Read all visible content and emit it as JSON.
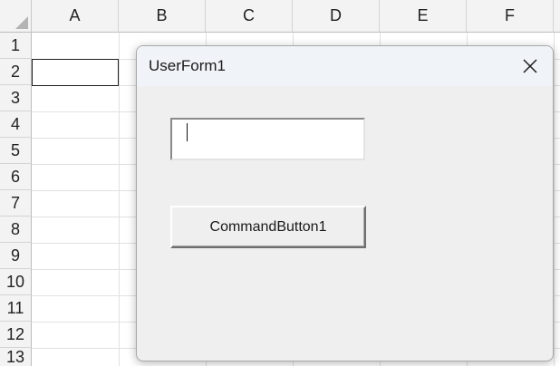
{
  "spreadsheet": {
    "columns": [
      "A",
      "B",
      "C",
      "D",
      "E",
      "F"
    ],
    "rows": [
      "1",
      "2",
      "3",
      "4",
      "5",
      "6",
      "7",
      "8",
      "9",
      "10",
      "11",
      "12",
      "13"
    ]
  },
  "userform": {
    "title": "UserForm1",
    "textbox_value": "",
    "button_label": "CommandButton1"
  },
  "colors": {
    "header_bg": "#f3f3f3",
    "dialog_bg": "#efefef",
    "titlebar_bg": "#f0f3f8",
    "gridline": "#e1e1e1"
  },
  "icons": {
    "close": "close-icon",
    "select_all": "select-all-triangle-icon"
  }
}
